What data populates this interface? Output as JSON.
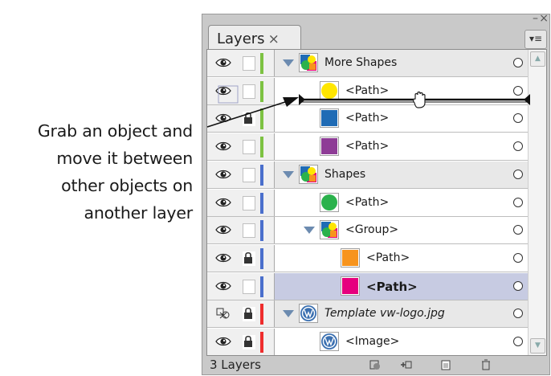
{
  "caption": {
    "lines": [
      "Grab an object and",
      "move it between",
      "other objects on",
      "another layer"
    ]
  },
  "panel": {
    "tab_label": "Layers",
    "tab_close": "×",
    "minimize": "–",
    "close": "×",
    "menu_icon": "panel-menu-icon"
  },
  "rows": [
    {
      "label": "More Shapes",
      "kind": "layer",
      "locked": false,
      "bar": "#7dc242",
      "thumb": "multi"
    },
    {
      "label": "<Path>",
      "kind": "path",
      "locked": false,
      "bar": "#7dc242",
      "thumb": "#ffe600"
    },
    {
      "label": "<Path>",
      "kind": "path",
      "locked": true,
      "bar": "#7dc242",
      "thumb": "#1f6bb5"
    },
    {
      "label": "<Path>",
      "kind": "path",
      "locked": false,
      "bar": "#7dc242",
      "thumb": "#8e3c96"
    },
    {
      "label": "Shapes",
      "kind": "layer",
      "locked": false,
      "bar": "#4a6fcc",
      "thumb": "multi"
    },
    {
      "label": "<Path>",
      "kind": "path",
      "locked": false,
      "bar": "#4a6fcc",
      "thumb": "#2bb24c"
    },
    {
      "label": "<Group>",
      "kind": "group",
      "locked": false,
      "bar": "#4a6fcc",
      "thumb": "multi"
    },
    {
      "label": "<Path>",
      "kind": "path",
      "locked": true,
      "bar": "#4a6fcc",
      "thumb": "#f7941d"
    },
    {
      "label": "<Path>",
      "kind": "path",
      "locked": false,
      "bar": "#4a6fcc",
      "thumb": "#e6007e",
      "selected": true
    },
    {
      "label": "Template vw-logo.jpg",
      "kind": "layer",
      "locked": true,
      "bar": "#ee2d2d",
      "thumb": "vw"
    },
    {
      "label": "<Image>",
      "kind": "image",
      "locked": true,
      "bar": "#ee2d2d",
      "thumb": "vw"
    }
  ],
  "footer": {
    "count": "3 Layers",
    "icons": [
      "make-clipping-mask-icon",
      "create-sublayer-icon",
      "new-layer-icon",
      "trash-icon"
    ]
  }
}
